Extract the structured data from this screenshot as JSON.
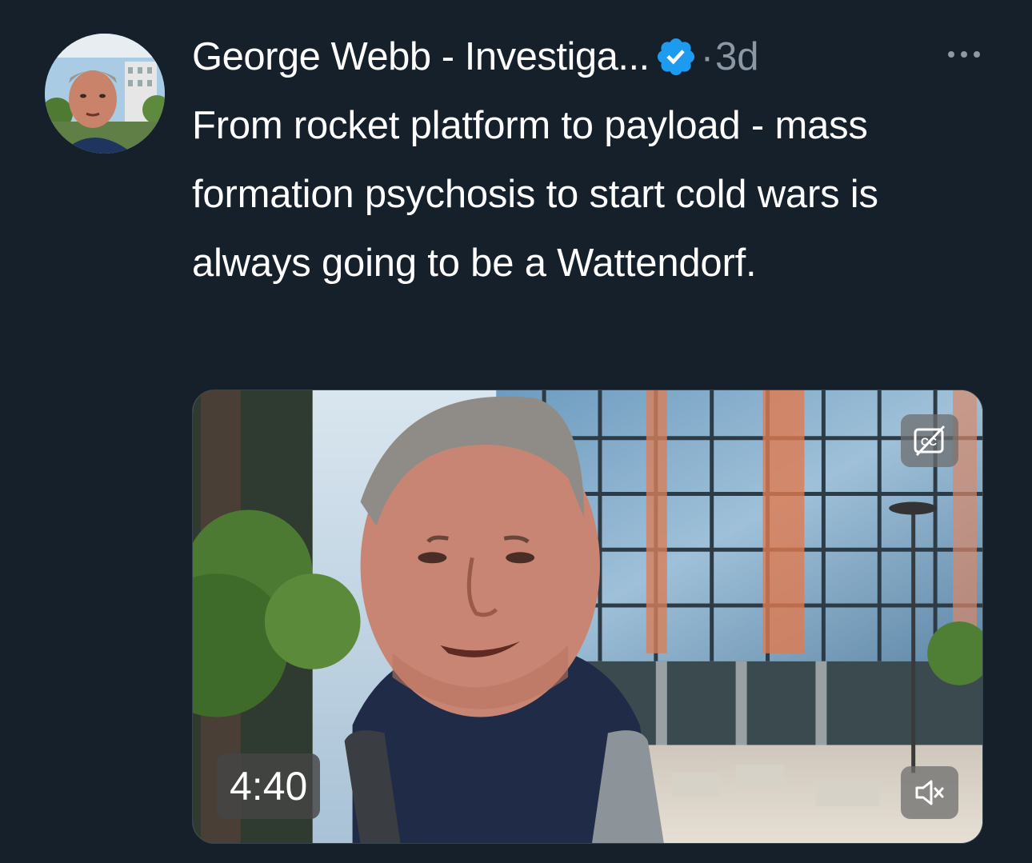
{
  "tweet": {
    "author_name": "George Webb - Investiga...",
    "separator": "·",
    "time": "3d",
    "text": "From rocket platform to payload - mass formation psychosis to start cold wars is always going to be a Wattendorf.",
    "verified": true
  },
  "media": {
    "type": "video",
    "duration": "4:40"
  },
  "icons": {
    "verified": "verified-badge-icon",
    "more": "more-horizontal-icon",
    "captions": "captions-off-icon",
    "volume": "volume-muted-icon"
  },
  "colors": {
    "background": "#15202b",
    "secondary_text": "#8b98a5",
    "verified_blue": "#1d9bf0"
  }
}
